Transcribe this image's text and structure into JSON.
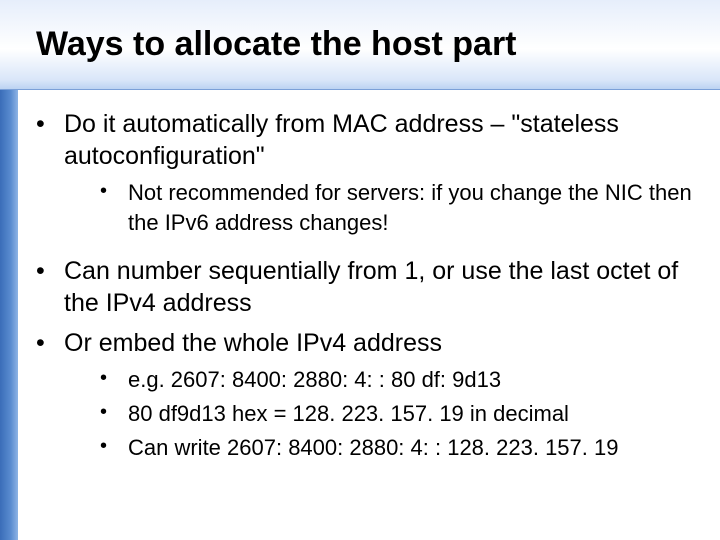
{
  "title": "Ways to allocate the host part",
  "bullets": {
    "b1": "Do it automatically from MAC address – \"stateless autoconfiguration\"",
    "b1_sub1": "Not recommended for servers: if you change the NIC then the IPv6 address changes!",
    "b2": "Can number sequentially from 1, or use the last octet of the IPv4 address",
    "b3": "Or embed the whole IPv4 address",
    "b3_sub1": "e.g. 2607: 8400: 2880: 4: : 80 df: 9d13",
    "b3_sub2": "80 df9d13 hex = 128. 223. 157. 19 in decimal",
    "b3_sub3": "Can write 2607: 8400: 2880: 4: : 128. 223. 157. 19"
  }
}
